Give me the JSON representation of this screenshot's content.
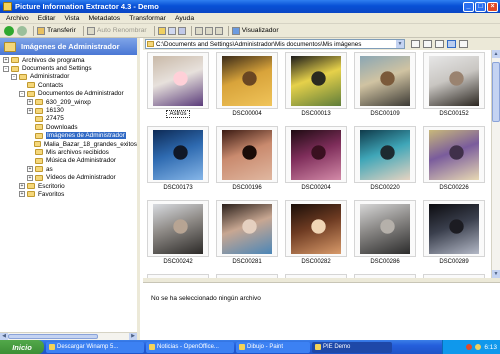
{
  "window": {
    "title": "Picture Information Extractor 4.3 - Demo"
  },
  "menu": [
    "Archivo",
    "Editar",
    "Vista",
    "Metadatos",
    "Transformar",
    "Ayuda"
  ],
  "toolbar": {
    "transfer_label": "Transferir",
    "auto_rename_label": "Auto Renombrar",
    "viewer_label": "Visualizador"
  },
  "sidebar": {
    "header": "Imágenes de Administrador",
    "tree": [
      {
        "label": "Archivos de programa",
        "depth": 0,
        "expander": "+",
        "selected": false
      },
      {
        "label": "Documents and Settings",
        "depth": 0,
        "expander": "-",
        "selected": false
      },
      {
        "label": "Administrador",
        "depth": 1,
        "expander": "-",
        "selected": false
      },
      {
        "label": "Contacts",
        "depth": 2,
        "expander": "",
        "selected": false
      },
      {
        "label": "Documentos de Administrador",
        "depth": 2,
        "expander": "-",
        "selected": false
      },
      {
        "label": "630_209_winxp",
        "depth": 3,
        "expander": "+",
        "selected": false
      },
      {
        "label": "16130",
        "depth": 3,
        "expander": "+",
        "selected": false
      },
      {
        "label": "27475",
        "depth": 3,
        "expander": "",
        "selected": false
      },
      {
        "label": "Downloads",
        "depth": 3,
        "expander": "",
        "selected": false
      },
      {
        "label": "Imágenes de Administrador",
        "depth": 3,
        "expander": "",
        "selected": true
      },
      {
        "label": "Malia_Bazar_18_grandes_exitos",
        "depth": 3,
        "expander": "",
        "selected": false
      },
      {
        "label": "Mis archivos recibidos",
        "depth": 3,
        "expander": "",
        "selected": false
      },
      {
        "label": "Música de Administrador",
        "depth": 3,
        "expander": "",
        "selected": false
      },
      {
        "label": "as",
        "depth": 3,
        "expander": "+",
        "selected": false
      },
      {
        "label": "Vídeos de Administrador",
        "depth": 3,
        "expander": "+",
        "selected": false
      },
      {
        "label": "Escritorio",
        "depth": 2,
        "expander": "+",
        "selected": false
      },
      {
        "label": "Favoritos",
        "depth": 2,
        "expander": "+",
        "selected": false
      }
    ]
  },
  "path": {
    "value": "C:\\Documents and Settings\\Administrador\\Mis documentos\\Mis imágenes"
  },
  "thumbnails": [
    {
      "label": "Astros",
      "focused": true,
      "palette": [
        "#c9b9a8",
        "#e7e1dc",
        "#5a3b7a",
        "#ffd0d8"
      ]
    },
    {
      "label": "DSC00004",
      "focused": false,
      "palette": [
        "#3a2a18",
        "#d8a33a",
        "#f0c45a",
        "#6a4622"
      ]
    },
    {
      "label": "DSC00013",
      "focused": false,
      "palette": [
        "#1b1a1a",
        "#e6d14a",
        "#5f7d3a",
        "#2a2a20"
      ]
    },
    {
      "label": "DSC00109",
      "focused": false,
      "palette": [
        "#8aa6b4",
        "#d0c3a2",
        "#3c3a35",
        "#7b5a3a"
      ]
    },
    {
      "label": "DSC00152",
      "focused": false,
      "palette": [
        "#e6e6e6",
        "#c9c6c2",
        "#2b2620",
        "#9a8370"
      ]
    },
    {
      "label": "DSC00173",
      "focused": false,
      "palette": [
        "#0d2a55",
        "#2e6ab0",
        "#86b6e8",
        "#101828"
      ]
    },
    {
      "label": "DSC00196",
      "focused": false,
      "palette": [
        "#3a1a12",
        "#c98a6e",
        "#e0b7a0",
        "#1a0c08"
      ]
    },
    {
      "label": "DSC00204",
      "focused": false,
      "palette": [
        "#1e0b12",
        "#7e2d5a",
        "#d38aa8",
        "#3a1020"
      ]
    },
    {
      "label": "DSC00220",
      "focused": false,
      "palette": [
        "#0f3a4a",
        "#3fa6b8",
        "#e6d3c1",
        "#1d2a30"
      ]
    },
    {
      "label": "DSC00226",
      "focused": false,
      "palette": [
        "#c8b87a",
        "#7a5c9c",
        "#e8d9b3",
        "#40304a"
      ]
    },
    {
      "label": "DSC00242",
      "focused": false,
      "palette": [
        "#d8dbe0",
        "#8e8a86",
        "#2c2a28",
        "#b7a493"
      ]
    },
    {
      "label": "DSC00281",
      "focused": false,
      "palette": [
        "#2a1f1a",
        "#c8a792",
        "#4b86b7",
        "#e5d0c0"
      ]
    },
    {
      "label": "DSC00282",
      "focused": false,
      "palette": [
        "#1a0e08",
        "#6e3b22",
        "#d89a6a",
        "#f0d5b5"
      ]
    },
    {
      "label": "DSC00286",
      "focused": false,
      "palette": [
        "#d6d6d6",
        "#898785",
        "#2c2c2c",
        "#b5b0aa"
      ]
    },
    {
      "label": "DSC00289",
      "focused": false,
      "palette": [
        "#0c0c10",
        "#3a3f4d",
        "#b3b8c6",
        "#1c1c22"
      ]
    },
    {
      "label": "",
      "focused": false,
      "palette": [
        "#8a5a3a",
        "#e2c2a2",
        "#3a2a1a",
        "#c0a080"
      ]
    },
    {
      "label": "",
      "focused": false,
      "palette": [
        "#b53a2a",
        "#e9d0b9",
        "#3a2620",
        "#c8866a"
      ]
    },
    {
      "label": "",
      "focused": false,
      "palette": [
        "#a86a30",
        "#f0e0c0",
        "#5a3a1e",
        "#d8b080"
      ]
    },
    {
      "label": "",
      "focused": false,
      "palette": [
        "#6a3c28",
        "#d8b094",
        "#2a1a12",
        "#b88a6a"
      ]
    },
    {
      "label": "",
      "focused": false,
      "palette": [
        "#2a2420",
        "#8c7060",
        "#e8d8c8",
        "#4a3a30"
      ]
    }
  ],
  "info": {
    "message": "No se ha seleccionado ningún archivo"
  },
  "taskbar": {
    "start_label": "Inicio",
    "tasks": [
      {
        "label": "Descargar Winamp 5...",
        "active": false
      },
      {
        "label": "Noticias - OpenOffice...",
        "active": false
      },
      {
        "label": "Dibujo - Paint",
        "active": false
      },
      {
        "label": "PIE Demo",
        "active": true
      }
    ],
    "clock": "6:13"
  }
}
